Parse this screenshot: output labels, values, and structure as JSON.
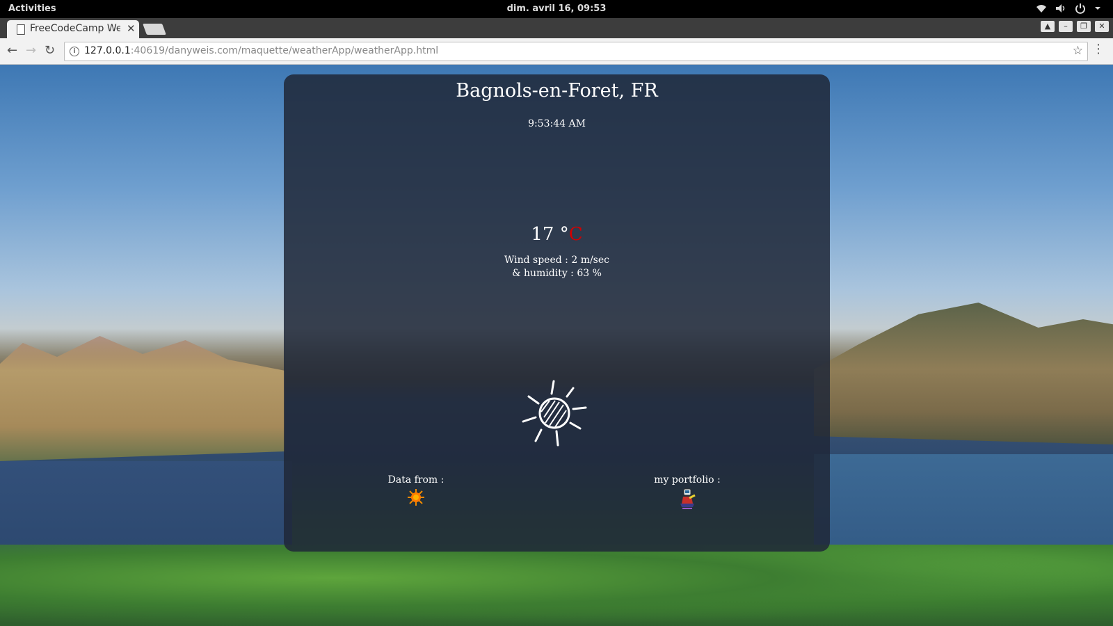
{
  "system_bar": {
    "activities": "Activities",
    "clock": "dim. avril 16, 09:53"
  },
  "browser": {
    "tab_title": "FreeCodeCamp We",
    "url_host": "127.0.0.1",
    "url_path": ":40619/danyweis.com/maquette/weatherApp/weatherApp.html"
  },
  "weather": {
    "location": "Bagnols-en-Foret, FR",
    "time": "9:53:44 AM",
    "temperature": "17 °",
    "unit": "C",
    "wind": "Wind speed : 2 m/sec",
    "humidity": "& humidity : 63 %",
    "condition_icon": "sun-icon"
  },
  "footer": {
    "data_from_label": "Data from :",
    "data_from_icon": "openweather-sun-icon",
    "portfolio_label": "my portfolio :",
    "portfolio_icon": "portfolio-character-icon"
  },
  "colors": {
    "card_background": "#202838",
    "unit_accent": "#d40000"
  }
}
